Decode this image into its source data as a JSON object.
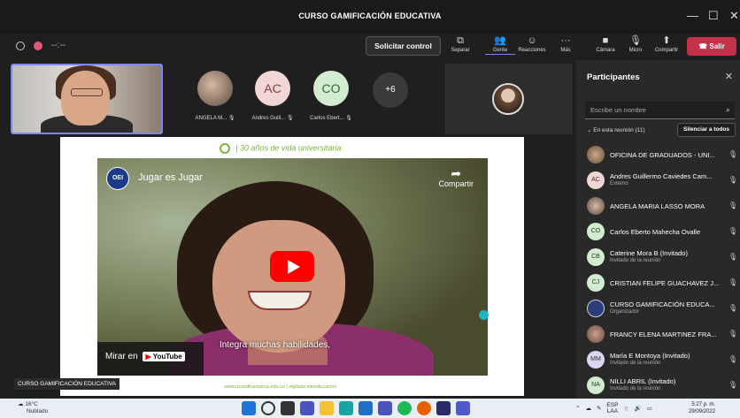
{
  "window": {
    "title": "CURSO GAMIFICACIÓN EDUCATIVA"
  },
  "toolbar": {
    "timer": "--:--",
    "request_control": "Solicitar control",
    "buttons": [
      {
        "label": "Separar",
        "icon": "separate-icon"
      },
      {
        "label": "Gente",
        "icon": "people-icon"
      },
      {
        "label": "Reacciones",
        "icon": "reactions-icon"
      },
      {
        "label": "Más",
        "icon": "more-icon"
      },
      {
        "label": "Cámara",
        "icon": "camera-off-icon"
      },
      {
        "label": "Micro",
        "icon": "mic-off-icon"
      },
      {
        "label": "Compartir",
        "icon": "share-icon"
      }
    ],
    "leave": "Salir",
    "leave_color": "#c4314b"
  },
  "stage_participants": [
    {
      "name": "ANGELA M...",
      "initials": "",
      "color": "#9a8f88"
    },
    {
      "name": "Andres Guill...",
      "initials": "AC",
      "color": "#f2d6d6"
    },
    {
      "name": "Carlos Ebert...",
      "initials": "CO",
      "color": "#d2ecd0"
    }
  ],
  "more_count": "+6",
  "slide": {
    "header": "30 años de vida universitaria",
    "footer": "www.ucundinamarca.edu.co  |  vigilada mineducación"
  },
  "video": {
    "channel_logo": "OEI",
    "title": "Jugar es Jugar",
    "share": "Compartir",
    "watch_on": "Mirar en",
    "youtube": "YouTube",
    "caption": "Integra muchas habilidades,"
  },
  "share_label": "CURSO GAMIFICACIÓN EDUCATIVA",
  "panel": {
    "title": "Participantes",
    "search_placeholder": "Escribe un nombre",
    "in_meeting": "En esta reunión (11)",
    "mute_all": "Silenciar a todos",
    "participants": [
      {
        "name": "OFICINA DE GRADUADOS - UNI...",
        "role": "",
        "initials": "",
        "color": "#8a6b4e"
      },
      {
        "name": "Andres Guillermo Caviedes Cam...",
        "role": "Externo",
        "initials": "AC",
        "color": "#f2d6d6"
      },
      {
        "name": "ANGELA MARIA LASSO MORA",
        "role": "",
        "initials": "",
        "color": "#9a8f88"
      },
      {
        "name": "Carlos Eberto Mahecha Ovalle",
        "role": "",
        "initials": "CO",
        "color": "#d2ecd0"
      },
      {
        "name": "Caterine Mora B (Invitado)",
        "role": "Invitado de la reunión",
        "initials": "CB",
        "color": "#d2ecd0"
      },
      {
        "name": "CRISTIAN FELIPE GUACHAVEZ J...",
        "role": "",
        "initials": "CJ",
        "color": "#d2ecd0"
      },
      {
        "name": "CURSO GAMIFICACIÓN EDUCA...",
        "role": "Organizador",
        "initials": "",
        "color": "#2c3e7a"
      },
      {
        "name": "FRANCY ELENA MARTINEZ FRA...",
        "role": "",
        "initials": "",
        "color": "#a07a6a"
      },
      {
        "name": "María E Montoya (Invitado)",
        "role": "Invitado de la reunión",
        "initials": "MM",
        "color": "#dcd6f2"
      },
      {
        "name": "NILLI ABRIL (Invitado)",
        "role": "Invitado de la reunión",
        "initials": "NA",
        "color": "#d2ecd0"
      }
    ]
  },
  "taskbar": {
    "temp": "16°C",
    "weather": "Nublado",
    "lang1": "ESP",
    "lang2": "LAA",
    "time": "5:27 p. m.",
    "date": "29/09/2022"
  }
}
